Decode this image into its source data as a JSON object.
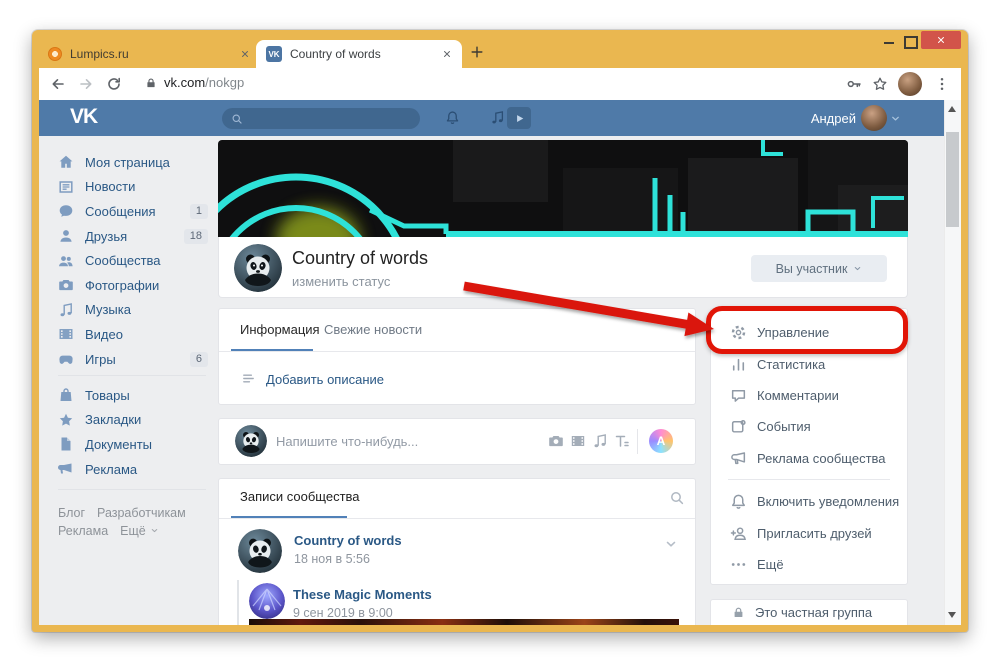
{
  "browser": {
    "tabs": [
      {
        "title": "Lumpics.ru"
      },
      {
        "title": "Country of words"
      }
    ],
    "url": {
      "host": "vk.com",
      "path": "/nokgp"
    }
  },
  "vk": {
    "logo": "VK",
    "user_name": "Андрей",
    "nav_main": [
      {
        "icon": "home",
        "label": "Моя страница"
      },
      {
        "icon": "news",
        "label": "Новости"
      },
      {
        "icon": "messages",
        "label": "Сообщения",
        "badge": "1"
      },
      {
        "icon": "friend",
        "label": "Друзья",
        "badge": "18"
      },
      {
        "icon": "groups",
        "label": "Сообщества"
      },
      {
        "icon": "camera",
        "label": "Фотографии"
      },
      {
        "icon": "music",
        "label": "Музыка"
      },
      {
        "icon": "video",
        "label": "Видео"
      },
      {
        "icon": "games",
        "label": "Игры",
        "badge": "6"
      }
    ],
    "nav_extra": [
      {
        "icon": "market",
        "label": "Товары"
      },
      {
        "icon": "bookmarks",
        "label": "Закладки"
      },
      {
        "icon": "docs",
        "label": "Документы"
      },
      {
        "icon": "promo",
        "label": "Реклама"
      }
    ],
    "footer_line1": [
      "Блог",
      "Разработчикам"
    ],
    "footer_line2": [
      "Реклама",
      "Ещё"
    ]
  },
  "community": {
    "name": "Country of words",
    "status_placeholder": "изменить статус",
    "member_button": "Вы участник",
    "tabs": [
      {
        "label": "Информация"
      },
      {
        "label": "Свежие новости"
      }
    ],
    "add_description": "Добавить описание",
    "composer_placeholder": "Напишите что-нибудь...",
    "composer_badge_letter": "A",
    "wall_title": "Записи сообщества",
    "post": {
      "author": "Country of words",
      "date": "18 ноя в 5:56"
    },
    "repost": {
      "author": "These Magic Moments",
      "date": "9 сен 2019 в 9:00"
    }
  },
  "actions": {
    "primary": [
      {
        "icon": "gear",
        "label": "Управление"
      },
      {
        "icon": "stats",
        "label": "Статистика"
      },
      {
        "icon": "comments",
        "label": "Комментарии"
      },
      {
        "icon": "events",
        "label": "События"
      },
      {
        "icon": "promo2",
        "label": "Реклама сообщества"
      }
    ],
    "secondary": [
      {
        "icon": "bell",
        "label": "Включить уведомления"
      },
      {
        "icon": "invite",
        "label": "Пригласить друзей"
      },
      {
        "icon": "more",
        "label": "Ещё"
      }
    ],
    "private_note": "Это частная группа"
  },
  "colors": {
    "frame": "#eab750",
    "header_blue": "#4f7aa8",
    "accent": "#5181b8",
    "link": "#2a5885",
    "highlight_red": "#e11507"
  }
}
